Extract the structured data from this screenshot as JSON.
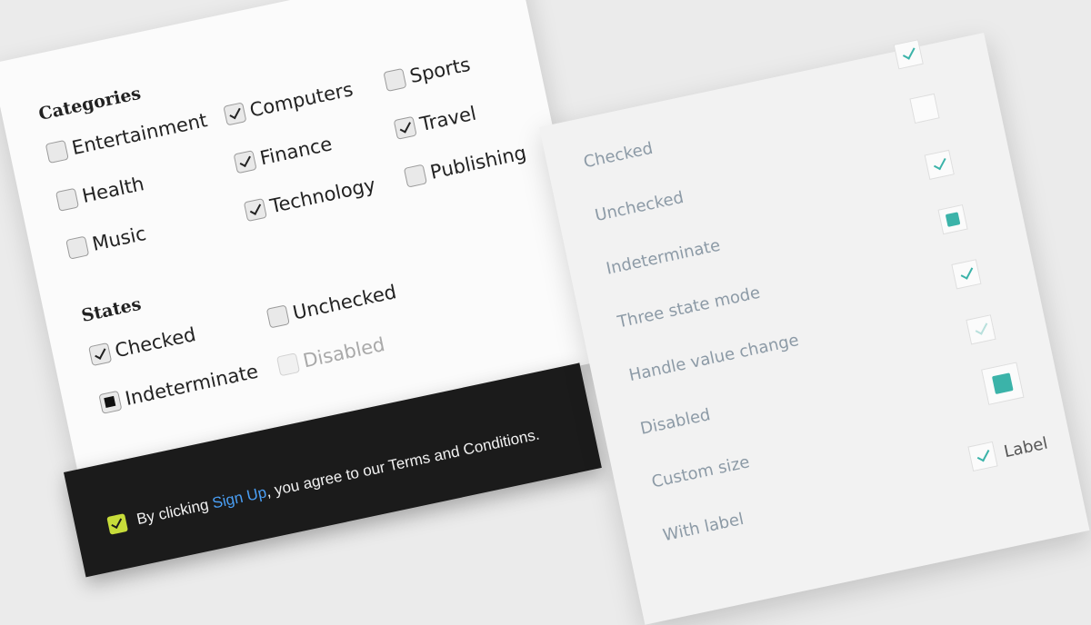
{
  "categories_card": {
    "heading": "Categories",
    "items": [
      {
        "label": "Entertainment",
        "checked": false
      },
      {
        "label": "Health",
        "checked": false
      },
      {
        "label": "Music",
        "checked": false
      },
      {
        "label": "Computers",
        "checked": true
      },
      {
        "label": "Finance",
        "checked": true
      },
      {
        "label": "Technology",
        "checked": true
      },
      {
        "label": "Sports",
        "checked": false
      },
      {
        "label": "Travel",
        "checked": true
      },
      {
        "label": "Publishing",
        "checked": false
      }
    ],
    "states_heading": "States",
    "states": [
      {
        "label": "Checked",
        "state": "checked"
      },
      {
        "label": "Indeterminate",
        "state": "indeterminate"
      },
      {
        "label": "Unchecked",
        "state": "unchecked"
      },
      {
        "label": "Disabled",
        "state": "disabled"
      }
    ]
  },
  "banner": {
    "before": "By clicking ",
    "link": "Sign Up",
    "after": ", you agree to our Terms and Conditions.",
    "checkbox_color": "#c7dc3a",
    "link_color": "#4a9ff5"
  },
  "states_card": {
    "labels": [
      "Checked",
      "Unchecked",
      "Indeterminate",
      "Three state mode",
      "Handle value change",
      "Disabled",
      "Custom size",
      "With label"
    ],
    "with_label_text": "Label",
    "accent_color": "#3bb3a9"
  }
}
